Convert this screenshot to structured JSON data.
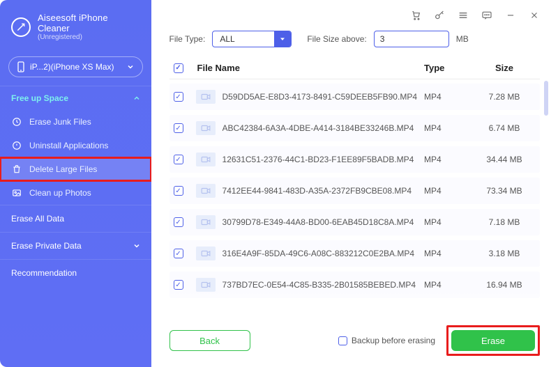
{
  "brand": {
    "line1": "Aiseesoft iPhone",
    "line2": "Cleaner",
    "status": "(Unregistered)"
  },
  "device": {
    "label": "iP...2)(iPhone XS Max)"
  },
  "sidebar": {
    "section_free": "Free up Space",
    "items": [
      {
        "label": "Erase Junk Files",
        "icon": "clock"
      },
      {
        "label": "Uninstall Applications",
        "icon": "circle-x"
      },
      {
        "label": "Delete Large Files",
        "icon": "trash",
        "active": true
      },
      {
        "label": "Clean up Photos",
        "icon": "photo"
      }
    ],
    "erase_all": "Erase All Data",
    "erase_private": "Erase Private Data",
    "recommendation": "Recommendation"
  },
  "filters": {
    "type_label": "File Type:",
    "type_value": "ALL",
    "size_label": "File Size above:",
    "size_value": "3",
    "size_unit": "MB"
  },
  "table": {
    "headers": {
      "name": "File Name",
      "type": "Type",
      "size": "Size"
    },
    "rows": [
      {
        "name": "D59DD5AE-E8D3-4173-8491-C59DEEB5FB90.MP4",
        "type": "MP4",
        "size": "7.28 MB"
      },
      {
        "name": "ABC42384-6A3A-4DBE-A414-3184BE33246B.MP4",
        "type": "MP4",
        "size": "6.74 MB"
      },
      {
        "name": "12631C51-2376-44C1-BD23-F1EE89F5BADB.MP4",
        "type": "MP4",
        "size": "34.44 MB"
      },
      {
        "name": "7412EE44-9841-483D-A35A-2372FB9CBE08.MP4",
        "type": "MP4",
        "size": "73.34 MB"
      },
      {
        "name": "30799D78-E349-44A8-BD00-6EAB45D18C8A.MP4",
        "type": "MP4",
        "size": "7.18 MB"
      },
      {
        "name": "316E4A9F-85DA-49C6-A08C-883212C0E2BA.MP4",
        "type": "MP4",
        "size": "3.18 MB"
      },
      {
        "name": "737BD7EC-0E54-4C85-B335-2B01585BEBED.MP4",
        "type": "MP4",
        "size": "16.94 MB"
      }
    ]
  },
  "footer": {
    "back": "Back",
    "backup": "Backup before erasing",
    "erase": "Erase"
  }
}
